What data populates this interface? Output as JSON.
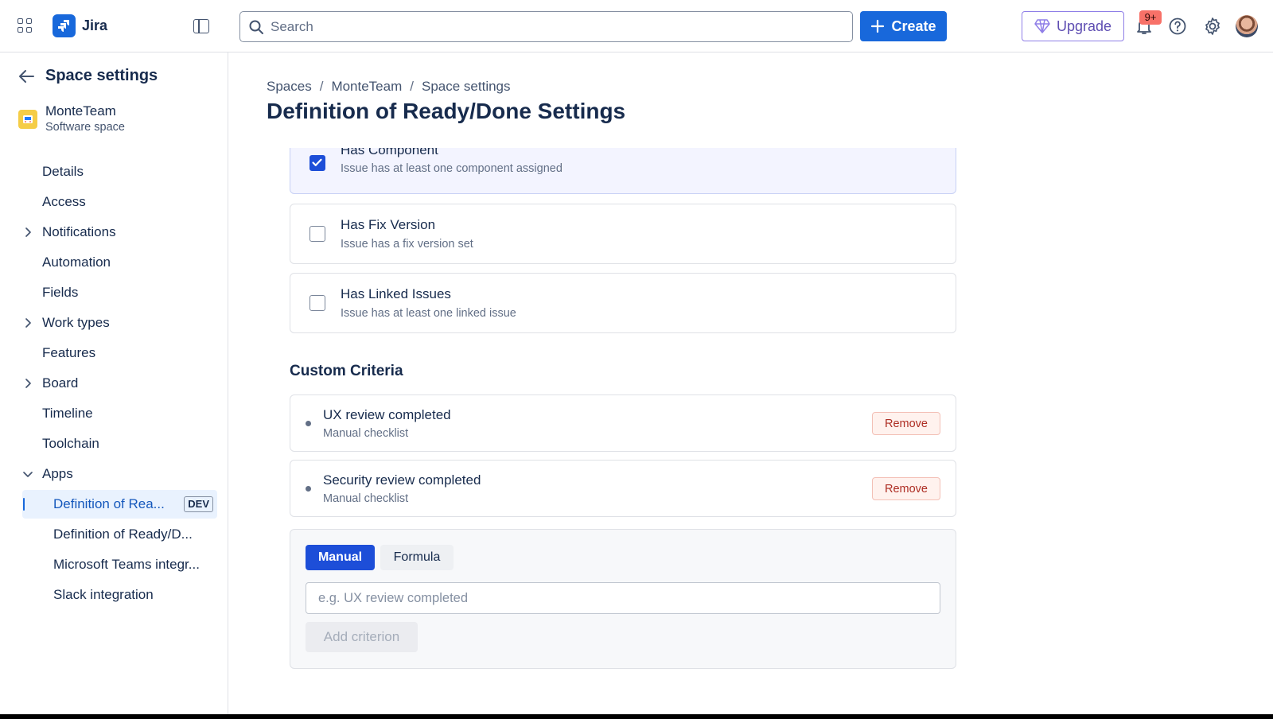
{
  "topbar": {
    "app_name": "Jira",
    "search_placeholder": "Search",
    "create_label": "Create",
    "upgrade_label": "Upgrade",
    "notifications_badge": "9+"
  },
  "sidebar": {
    "title": "Space settings",
    "project": {
      "name": "MonteTeam",
      "type": "Software space"
    },
    "items": [
      {
        "label": "Details"
      },
      {
        "label": "Access"
      },
      {
        "label": "Notifications"
      },
      {
        "label": "Automation"
      },
      {
        "label": "Fields"
      },
      {
        "label": "Work types"
      },
      {
        "label": "Features"
      },
      {
        "label": "Board"
      },
      {
        "label": "Timeline"
      },
      {
        "label": "Toolchain"
      },
      {
        "label": "Apps"
      },
      {
        "label": "Definition of Rea...",
        "tag": "DEV"
      },
      {
        "label": "Definition of Ready/D..."
      },
      {
        "label": "Microsoft Teams integr..."
      },
      {
        "label": "Slack integration"
      }
    ]
  },
  "breadcrumbs": [
    "Spaces",
    "MonteTeam",
    "Space settings"
  ],
  "page_title": "Definition of Ready/Done Settings",
  "checks": [
    {
      "title": "Has Component",
      "desc": "Issue has at least one component assigned",
      "checked": true
    },
    {
      "title": "Has Fix Version",
      "desc": "Issue has a fix version set",
      "checked": false
    },
    {
      "title": "Has Linked Issues",
      "desc": "Issue has at least one linked issue",
      "checked": false
    }
  ],
  "custom": {
    "title": "Custom Criteria",
    "items": [
      {
        "title": "UX review completed",
        "sub": "Manual checklist",
        "remove": "Remove"
      },
      {
        "title": "Security review completed",
        "sub": "Manual checklist",
        "remove": "Remove"
      }
    ],
    "mode_manual": "Manual",
    "mode_formula": "Formula",
    "input_placeholder": "e.g. UX review completed",
    "add_label": "Add criterion"
  }
}
